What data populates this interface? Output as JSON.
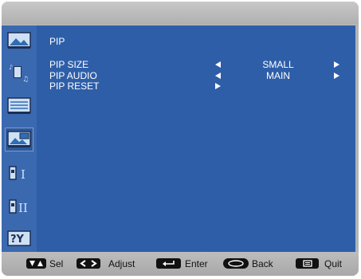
{
  "menu": {
    "title": "PIP",
    "items": [
      {
        "label": "PIP SIZE",
        "value": "SMALL",
        "has_left_arrow": true,
        "has_right_arrow": true
      },
      {
        "label": "PIP AUDIO",
        "value": "MAIN",
        "has_left_arrow": true,
        "has_right_arrow": true
      },
      {
        "label": "PIP RESET",
        "value": "",
        "has_left_arrow": false,
        "has_right_arrow": true
      }
    ]
  },
  "sidebar": {
    "icons": [
      "picture-icon",
      "audio-icon",
      "screen-icon",
      "pip-icon",
      "input1-icon",
      "input2-icon",
      "option-icon"
    ],
    "active": "pip-icon"
  },
  "footer": {
    "sel_label": "Sel",
    "adjust_label": "Adjust",
    "enter_label": "Enter",
    "back_label": "Back",
    "quit_label": "Quit"
  },
  "colors": {
    "panel": "#2e5ea8",
    "sidebar": "#3b69b0",
    "frame": "#b5b5b5"
  }
}
